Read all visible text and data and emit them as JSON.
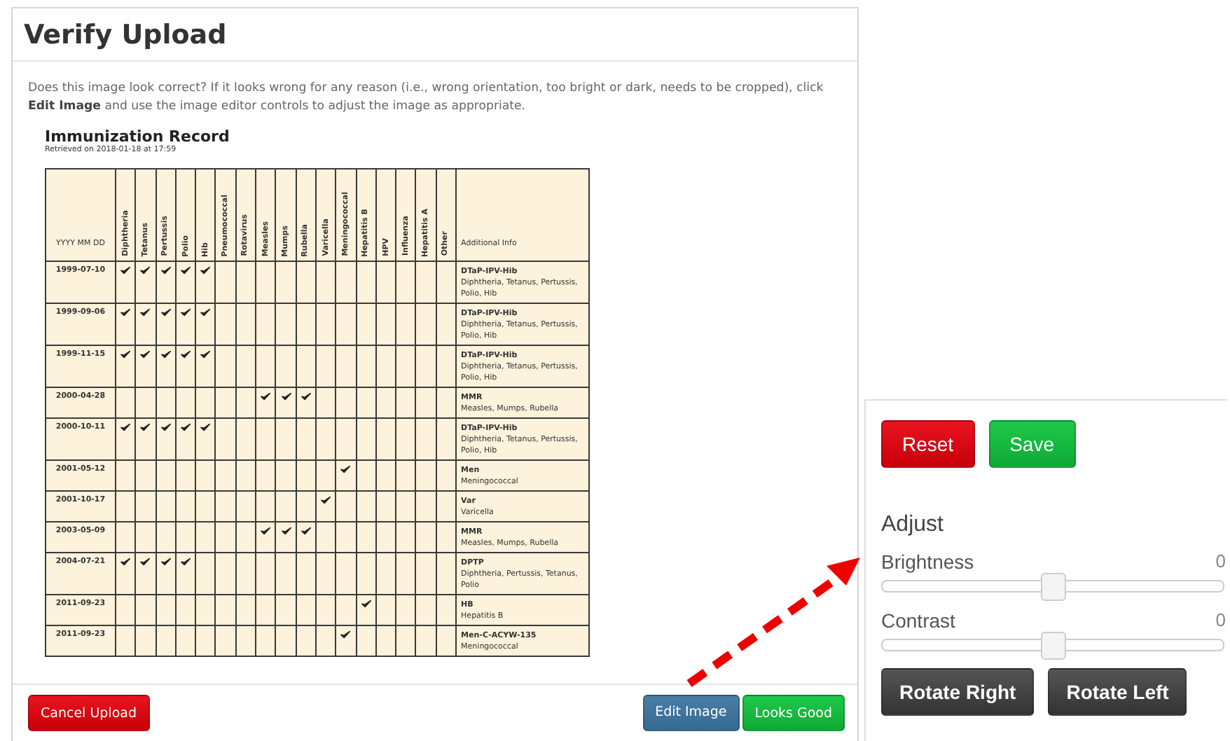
{
  "dialog": {
    "title": "Verify Upload",
    "message": "Does this image look correct? If it looks wrong for any reason (i.e., wrong orientation, too bright or dark, needs to be cropped), click **Edit Image** and use the image editor controls to adjust the image as appropriate."
  },
  "record": {
    "title": "Immunization Record",
    "subtitle": "Retrieved on 2018-01-18 at 17:59",
    "date_header": "YYYY MM DD",
    "info_header": "Additional Info",
    "columns": [
      "Diphtheria",
      "Tetanus",
      "Pertussis",
      "Polio",
      "Hib",
      "Pneumococcal",
      "Rotavirus",
      "Measles",
      "Mumps",
      "Rubella",
      "Varicella",
      "Meningococcal",
      "Hepatitis B",
      "HPV",
      "Influenza",
      "Hepatitis A",
      "Other"
    ],
    "rows": [
      {
        "date": "1999-07-10",
        "doses": [
          true,
          true,
          true,
          true,
          true,
          false,
          false,
          false,
          false,
          false,
          false,
          false,
          false,
          false,
          false,
          false,
          false
        ],
        "info_title": "DTaP-IPV-Hib",
        "info_text": "Diphtheria, Tetanus, Pertussis, Polio, Hib"
      },
      {
        "date": "1999-09-06",
        "doses": [
          true,
          true,
          true,
          true,
          true,
          false,
          false,
          false,
          false,
          false,
          false,
          false,
          false,
          false,
          false,
          false,
          false
        ],
        "info_title": "DTaP-IPV-Hib",
        "info_text": "Diphtheria, Tetanus, Pertussis, Polio, Hib"
      },
      {
        "date": "1999-11-15",
        "doses": [
          true,
          true,
          true,
          true,
          true,
          false,
          false,
          false,
          false,
          false,
          false,
          false,
          false,
          false,
          false,
          false,
          false
        ],
        "info_title": "DTaP-IPV-Hib",
        "info_text": "Diphtheria, Tetanus, Pertussis, Polio, Hib"
      },
      {
        "date": "2000-04-28",
        "doses": [
          false,
          false,
          false,
          false,
          false,
          false,
          false,
          true,
          true,
          true,
          false,
          false,
          false,
          false,
          false,
          false,
          false
        ],
        "info_title": "MMR",
        "info_text": "Measles, Mumps, Rubella"
      },
      {
        "date": "2000-10-11",
        "doses": [
          true,
          true,
          true,
          true,
          true,
          false,
          false,
          false,
          false,
          false,
          false,
          false,
          false,
          false,
          false,
          false,
          false
        ],
        "info_title": "DTaP-IPV-Hib",
        "info_text": "Diphtheria, Tetanus, Pertussis, Polio, Hib"
      },
      {
        "date": "2001-05-12",
        "doses": [
          false,
          false,
          false,
          false,
          false,
          false,
          false,
          false,
          false,
          false,
          false,
          true,
          false,
          false,
          false,
          false,
          false
        ],
        "info_title": "Men",
        "info_text": "Meningococcal"
      },
      {
        "date": "2001-10-17",
        "doses": [
          false,
          false,
          false,
          false,
          false,
          false,
          false,
          false,
          false,
          false,
          true,
          false,
          false,
          false,
          false,
          false,
          false
        ],
        "info_title": "Var",
        "info_text": "Varicella"
      },
      {
        "date": "2003-05-09",
        "doses": [
          false,
          false,
          false,
          false,
          false,
          false,
          false,
          true,
          true,
          true,
          false,
          false,
          false,
          false,
          false,
          false,
          false
        ],
        "info_title": "MMR",
        "info_text": "Measles, Mumps, Rubella"
      },
      {
        "date": "2004-07-21",
        "doses": [
          true,
          true,
          true,
          true,
          false,
          false,
          false,
          false,
          false,
          false,
          false,
          false,
          false,
          false,
          false,
          false,
          false
        ],
        "info_title": "DPTP",
        "info_text": "Diphtheria, Pertussis, Tetanus, Polio"
      },
      {
        "date": "2011-09-23",
        "doses": [
          false,
          false,
          false,
          false,
          false,
          false,
          false,
          false,
          false,
          false,
          false,
          false,
          true,
          false,
          false,
          false,
          false
        ],
        "info_title": "HB",
        "info_text": "Hepatitis B"
      },
      {
        "date": "2011-09-23",
        "doses": [
          false,
          false,
          false,
          false,
          false,
          false,
          false,
          false,
          false,
          false,
          false,
          true,
          false,
          false,
          false,
          false,
          false
        ],
        "info_title": "Men-C-ACYW-135",
        "info_text": "Meningococcal"
      }
    ]
  },
  "footer_buttons": [
    {
      "label": "Cancel Upload",
      "kind": "danger"
    },
    {
      "label": "Edit Image",
      "kind": "info"
    },
    {
      "label": "Looks Good",
      "kind": "success"
    }
  ],
  "editor": {
    "top_buttons": [
      {
        "label": "Reset",
        "kind": "danger"
      },
      {
        "label": "Save",
        "kind": "success"
      }
    ],
    "section_title": "Adjust",
    "sliders": [
      {
        "label": "Brightness",
        "value": "0",
        "level": 0.5
      },
      {
        "label": "Contrast",
        "value": "0",
        "level": 0.5
      }
    ],
    "rotate_buttons": [
      "Rotate Right",
      "Rotate Left"
    ]
  }
}
